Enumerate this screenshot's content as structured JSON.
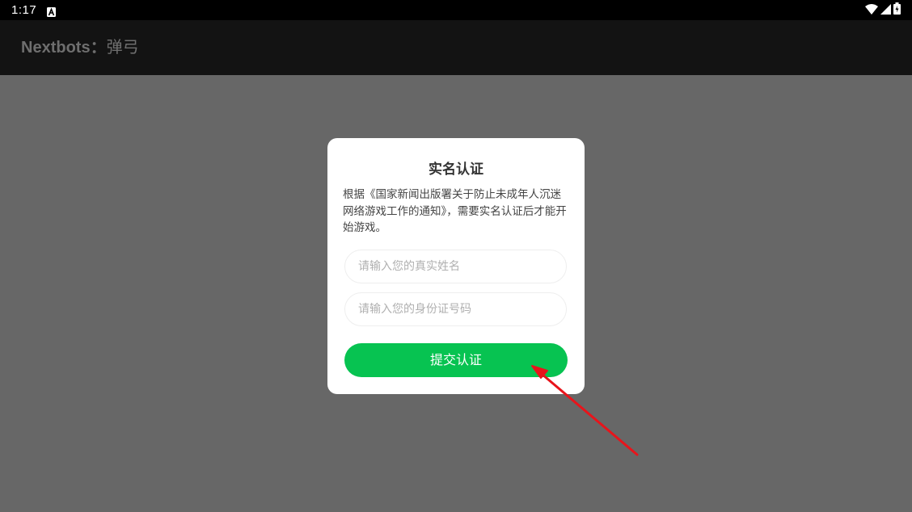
{
  "status_bar": {
    "time": "1:17",
    "icons": [
      "notification-a-icon",
      "wifi-icon",
      "signal-icon",
      "battery-icon"
    ]
  },
  "app_bar": {
    "title_latin": "Nextbots：",
    "title_cn": "弹弓"
  },
  "dialog": {
    "title": "实名认证",
    "description": "根据《国家新闻出版署关于防止未成年人沉迷网络游戏工作的通知》，需要实名认证后才能开始游戏。",
    "name_input": {
      "placeholder": "请输入您的真实姓名",
      "value": ""
    },
    "id_input": {
      "placeholder": "请输入您的身份证号码",
      "value": ""
    },
    "submit_label": "提交认证"
  },
  "colors": {
    "overlay": "#676767",
    "app_bar": "#131313",
    "accent_green": "#07c351",
    "annotation_red": "#e8141b"
  }
}
